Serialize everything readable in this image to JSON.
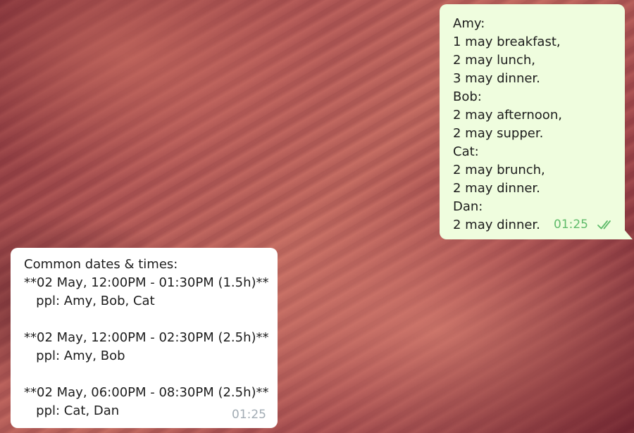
{
  "messages": {
    "outgoing": {
      "lines": [
        "Amy:",
        "1 may breakfast,",
        "2 may lunch,",
        "3 may dinner.",
        "Bob:",
        "2 may afternoon,",
        "2 may supper.",
        "Cat:",
        "2 may brunch,",
        "2 may dinner.",
        "Dan:",
        "2 may dinner."
      ],
      "time": "01:25",
      "status_icon": "double-check-read-icon",
      "bubble_color": "#effdde",
      "time_color": "#5fbb6a"
    },
    "incoming": {
      "lines": [
        "Common dates & times:",
        "**02 May, 12:00PM - 01:30PM (1.5h)**",
        "   ppl: Amy, Bob, Cat",
        "",
        "**02 May, 12:00PM - 02:30PM (2.5h)**",
        "   ppl: Amy, Bob",
        "",
        "**02 May, 06:00PM - 08:30PM (2.5h)**",
        "   ppl: Cat, Dan"
      ],
      "time": "01:25",
      "bubble_color": "#ffffff",
      "time_color": "#a2acb4"
    }
  }
}
